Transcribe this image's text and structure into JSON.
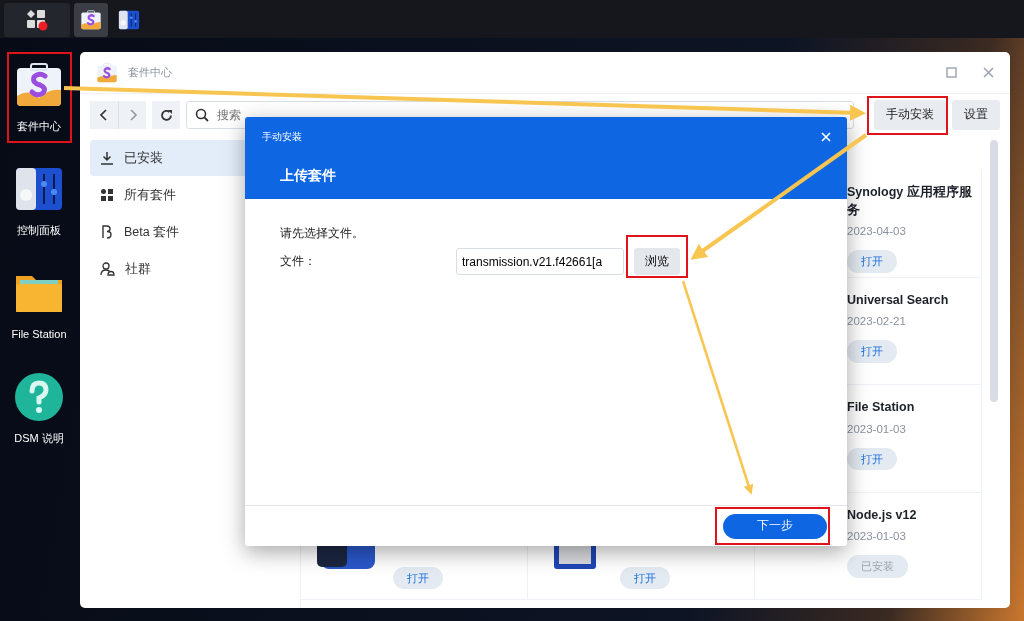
{
  "taskbar": {
    "menu": {
      "notification": true
    },
    "apps": [
      {
        "kind": "package-center",
        "selected": true
      },
      {
        "kind": "control-panel",
        "selected": false
      }
    ]
  },
  "desktop_icons": [
    {
      "label": "套件中心",
      "kind": "package-center"
    },
    {
      "label": "控制面板",
      "kind": "control-panel"
    },
    {
      "label": "File Station",
      "kind": "folder"
    },
    {
      "label": "DSM 说明",
      "kind": "help"
    }
  ],
  "window": {
    "title": "套件中心",
    "search": {
      "placeholder": "搜索"
    },
    "buttons": [
      "手动安装",
      "设置"
    ],
    "sidebar": [
      {
        "label": "已安装",
        "kind": "download",
        "selected": true
      },
      {
        "label": "所有套件",
        "kind": "grid",
        "selected": false
      },
      {
        "label": "Beta 套件",
        "kind": "beta",
        "selected": false
      },
      {
        "label": "社群",
        "kind": "people",
        "selected": false
      }
    ],
    "packages": [
      {
        "title": "Synology 应用程序服务",
        "date": "2023-04-03",
        "button": {
          "label": "打开",
          "disabled": false
        }
      },
      {
        "title": "Universal Search",
        "date": "2023-02-21",
        "button": {
          "label": "打开",
          "disabled": false
        }
      },
      {
        "title": "File Station",
        "date": "2023-01-03",
        "button": {
          "label": "打开",
          "disabled": false
        }
      },
      {
        "button": {
          "label": "打开",
          "disabled": false
        }
      },
      {
        "button": {
          "label": "打开",
          "disabled": false
        }
      },
      {
        "title": "Node.js v12",
        "date": "2023-01-03",
        "button": {
          "label": "已安装",
          "disabled": true
        }
      }
    ]
  },
  "dialog": {
    "title": "手动安装",
    "heading": "上传套件",
    "message": "请先选择文件。",
    "file_label": "文件：",
    "file_value": "transmission.v21.f42661[a",
    "browse": "浏览",
    "next": "下一步"
  }
}
